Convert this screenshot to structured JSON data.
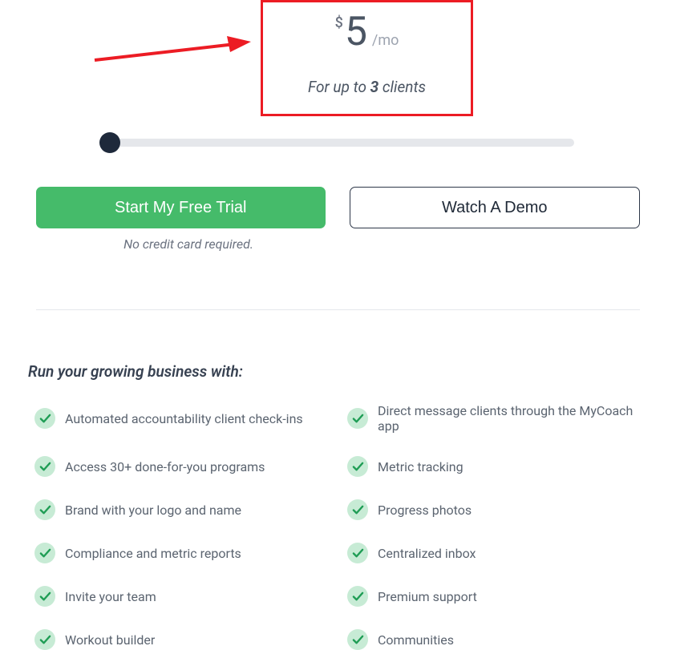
{
  "pricing": {
    "currency": "$",
    "amount": "5",
    "period": "/mo",
    "caption_prefix": "For up to ",
    "caption_bold": "3",
    "caption_suffix": " clients"
  },
  "cta": {
    "primary": "Start My Free Trial",
    "secondary": "Watch A Demo",
    "note": "No credit card required."
  },
  "features": {
    "heading": "Run your growing business with:",
    "left": [
      "Automated accountability client check-ins",
      "Access 30+ done-for-you programs",
      "Brand with your logo and name",
      "Compliance and metric reports",
      "Invite your team",
      "Workout builder"
    ],
    "right": [
      "Direct message clients through the MyCoach app",
      "Metric tracking",
      "Progress photos",
      "Centralized inbox",
      "Premium support",
      "Communities"
    ]
  },
  "annotation": {
    "highlight_color": "#ec1c24",
    "arrow_color": "#ec1c24"
  }
}
